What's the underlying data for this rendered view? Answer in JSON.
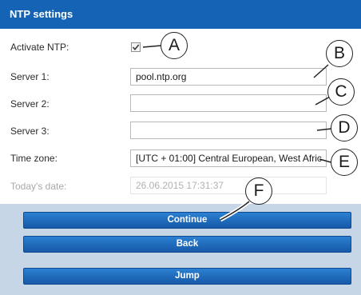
{
  "header": {
    "title": "NTP settings"
  },
  "form": {
    "activate_ntp": {
      "label": "Activate NTP:",
      "checked": true
    },
    "server1": {
      "label": "Server 1:",
      "value": "pool.ntp.org"
    },
    "server2": {
      "label": "Server 2:",
      "value": ""
    },
    "server3": {
      "label": "Server 3:",
      "value": ""
    },
    "timezone": {
      "label": "Time zone:",
      "value": "[UTC + 01:00] Central European, West Afric"
    },
    "date": {
      "label": "Today's date:",
      "value": "26.06.2015 17:31:37"
    }
  },
  "buttons": {
    "continue": "Continue",
    "back": "Back",
    "jump": "Jump"
  },
  "callouts": {
    "a": "A",
    "b": "B",
    "c": "C",
    "d": "D",
    "e": "E",
    "f": "F"
  }
}
